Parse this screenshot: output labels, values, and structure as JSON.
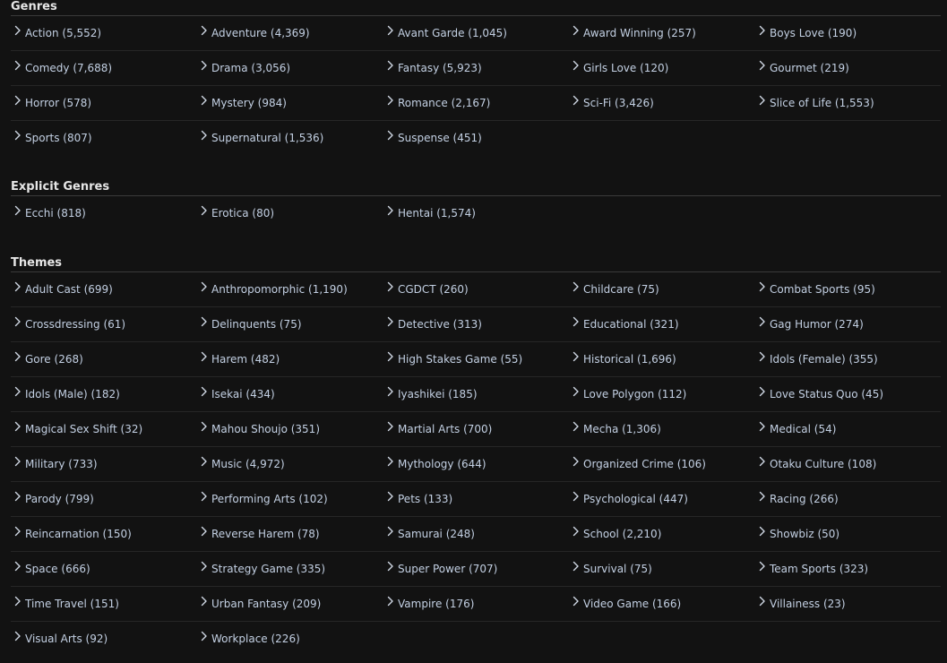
{
  "colors": {
    "background": "#121212",
    "link_text": "#c3d0e3",
    "heading": "#e6e6e6",
    "divider": "#3a3a3a"
  },
  "icons": {
    "item_prefix": "chevron-right-icon"
  },
  "sections": [
    {
      "title": "Genres",
      "items": [
        "Action (5,552)",
        "Adventure (4,369)",
        "Avant Garde (1,045)",
        "Award Winning (257)",
        "Boys Love (190)",
        "Comedy (7,688)",
        "Drama (3,056)",
        "Fantasy (5,923)",
        "Girls Love (120)",
        "Gourmet (219)",
        "Horror (578)",
        "Mystery (984)",
        "Romance (2,167)",
        "Sci-Fi (3,426)",
        "Slice of Life (1,553)",
        "Sports (807)",
        "Supernatural (1,536)",
        "Suspense (451)"
      ]
    },
    {
      "title": "Explicit Genres",
      "items": [
        "Ecchi (818)",
        "Erotica (80)",
        "Hentai (1,574)"
      ]
    },
    {
      "title": "Themes",
      "items": [
        "Adult Cast (699)",
        "Anthropomorphic (1,190)",
        "CGDCT (260)",
        "Childcare (75)",
        "Combat Sports (95)",
        "Crossdressing (61)",
        "Delinquents (75)",
        "Detective (313)",
        "Educational (321)",
        "Gag Humor (274)",
        "Gore (268)",
        "Harem (482)",
        "High Stakes Game (55)",
        "Historical (1,696)",
        "Idols (Female) (355)",
        "Idols (Male) (182)",
        "Isekai (434)",
        "Iyashikei (185)",
        "Love Polygon (112)",
        "Love Status Quo (45)",
        "Magical Sex Shift (32)",
        "Mahou Shoujo (351)",
        "Martial Arts (700)",
        "Mecha (1,306)",
        "Medical (54)",
        "Military (733)",
        "Music (4,972)",
        "Mythology (644)",
        "Organized Crime (106)",
        "Otaku Culture (108)",
        "Parody (799)",
        "Performing Arts (102)",
        "Pets (133)",
        "Psychological (447)",
        "Racing (266)",
        "Reincarnation (150)",
        "Reverse Harem (78)",
        "Samurai (248)",
        "School (2,210)",
        "Showbiz (50)",
        "Space (666)",
        "Strategy Game (335)",
        "Super Power (707)",
        "Survival (75)",
        "Team Sports (323)",
        "Time Travel (151)",
        "Urban Fantasy (209)",
        "Vampire (176)",
        "Video Game (166)",
        "Villainess (23)",
        "Visual Arts (92)",
        "Workplace (226)"
      ]
    }
  ]
}
